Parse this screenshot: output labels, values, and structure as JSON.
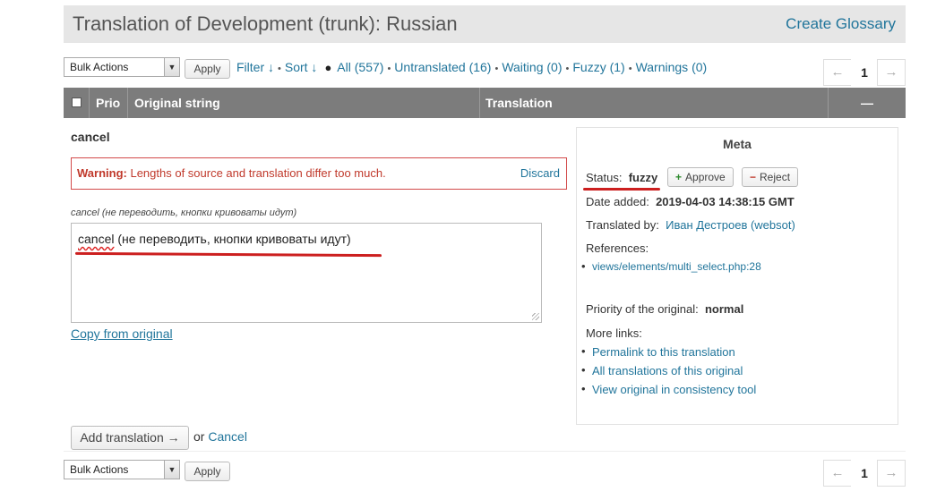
{
  "header": {
    "title": "Translation of Development (trunk): Russian",
    "glossary_link": "Create Glossary"
  },
  "toolbar": {
    "bulk_actions": "Bulk Actions",
    "apply": "Apply",
    "filter": "Filter ↓",
    "sort": "Sort ↓",
    "all": "All (557)",
    "untranslated": "Untranslated (16)",
    "waiting": "Waiting (0)",
    "fuzzy": "Fuzzy (1)",
    "warnings": "Warnings (0)"
  },
  "pager": {
    "prev": "←",
    "current": "1",
    "next": "→"
  },
  "table": {
    "columns": {
      "prio": "Prio",
      "original": "Original string",
      "translation": "Translation",
      "collapse": "—"
    }
  },
  "editor": {
    "original": "cancel",
    "warning_label": "Warning:",
    "warning_text": "Lengths of source and translation differ too much.",
    "discard": "Discard",
    "context": "cancel (не переводить, кнопки кривоваты идут)",
    "translation_word": "cancel",
    "translation_rest": " (не переводить, кнопки кривоваты идут)",
    "copy_from_original": "Copy from original",
    "add_translation": "Add translation →",
    "or": "or",
    "cancel": "Cancel"
  },
  "meta": {
    "title": "Meta",
    "status_label": "Status:",
    "status_value": "fuzzy",
    "approve": "Approve",
    "reject": "Reject",
    "date_label": "Date added:",
    "date_value": "2019-04-03 14:38:15 GMT",
    "translated_by_label": "Translated by:",
    "translated_by_value": "Иван Дестроев (websot)",
    "references_label": "References:",
    "reference": "views/elements/multi_select.php:28",
    "priority_label": "Priority of the original:",
    "priority_value": "normal",
    "more_links_label": "More links:",
    "links": [
      "Permalink to this translation",
      "All translations of this original",
      "View original in consistency tool"
    ]
  },
  "colors": {
    "link": "#21759b",
    "warning": "#c0392b",
    "table_header": "#7c7c7c",
    "annotation": "#cc1f1f"
  }
}
